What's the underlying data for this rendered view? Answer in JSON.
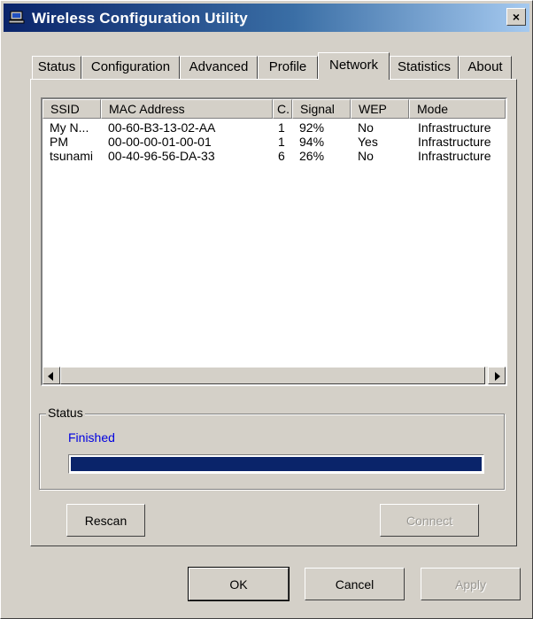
{
  "window": {
    "title": "Wireless Configuration Utility",
    "close_label": "×"
  },
  "tabs": [
    {
      "label": "Status"
    },
    {
      "label": "Configuration"
    },
    {
      "label": "Advanced"
    },
    {
      "label": "Profile"
    },
    {
      "label": "Network",
      "active": true
    },
    {
      "label": "Statistics"
    },
    {
      "label": "About"
    }
  ],
  "network_list": {
    "columns": [
      "SSID",
      "MAC Address",
      "C.",
      "Signal",
      "WEP",
      "Mode"
    ],
    "rows": [
      {
        "ssid": "My N...",
        "mac": "00-60-B3-13-02-AA",
        "channel": "1",
        "signal": "92%",
        "wep": "No",
        "mode": "Infrastructure"
      },
      {
        "ssid": "PM",
        "mac": "00-00-00-01-00-01",
        "channel": "1",
        "signal": "94%",
        "wep": "Yes",
        "mode": "Infrastructure"
      },
      {
        "ssid": "tsunami",
        "mac": "00-40-96-56-DA-33",
        "channel": "6",
        "signal": "26%",
        "wep": "No",
        "mode": "Infrastructure"
      }
    ]
  },
  "status_group": {
    "label": "Status",
    "text": "Finished",
    "progress": 1.0
  },
  "buttons": {
    "rescan": "Rescan",
    "connect": "Connect",
    "ok": "OK",
    "cancel": "Cancel",
    "apply": "Apply"
  },
  "colors": {
    "titlebar_start": "#0a246a",
    "titlebar_end": "#a6caf0",
    "status_text": "#0000e0",
    "progress_fill": "#0a246a"
  },
  "icons": {
    "app": "network-computer-icon"
  }
}
